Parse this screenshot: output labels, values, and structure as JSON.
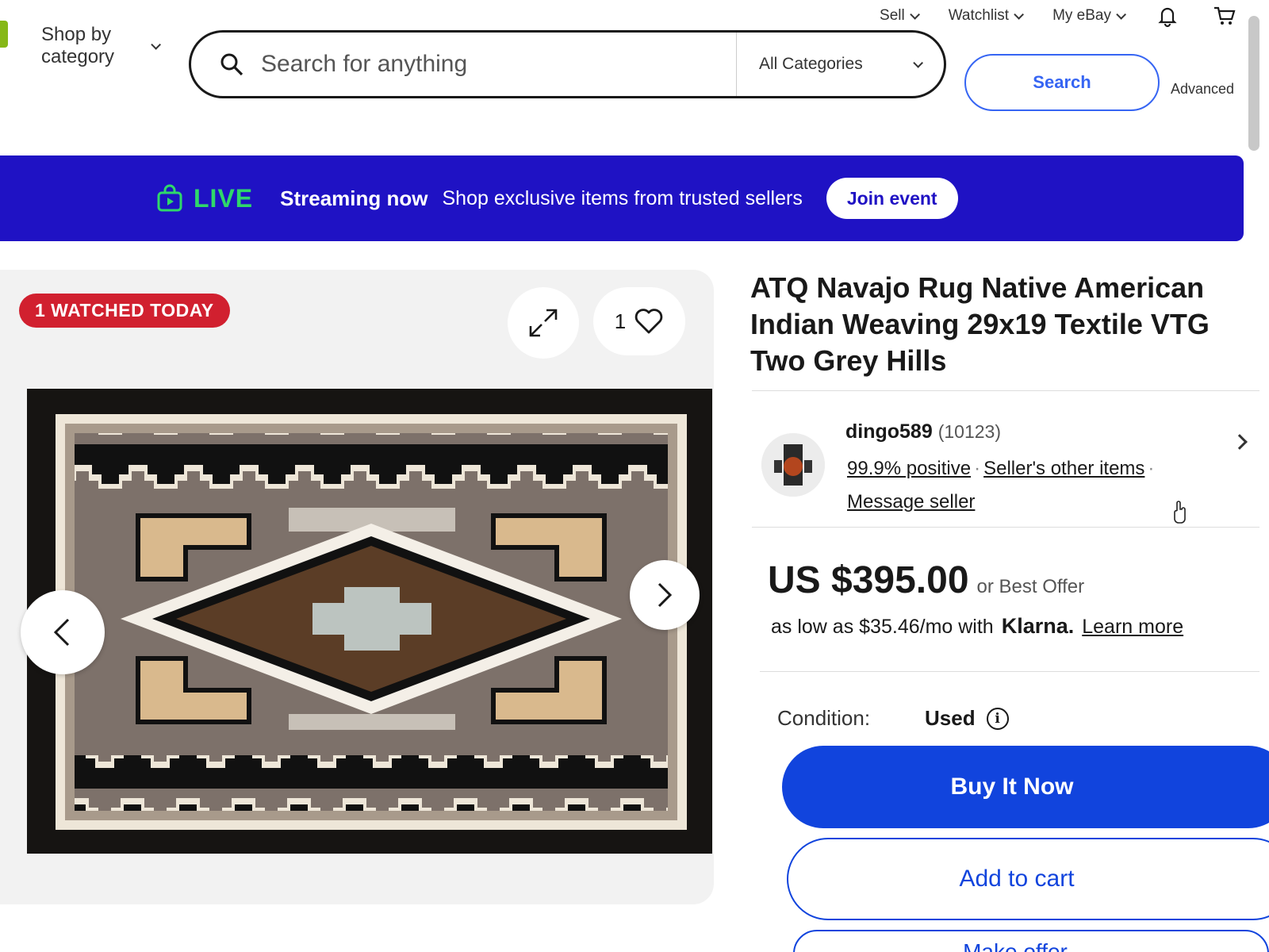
{
  "header": {
    "shop_by_category": "Shop by category",
    "top_links": [
      {
        "label": "Sell"
      },
      {
        "label": "Watchlist"
      },
      {
        "label": "My eBay"
      }
    ],
    "search": {
      "placeholder": "Search for anything",
      "category": "All Categories",
      "button": "Search",
      "advanced": "Advanced"
    },
    "icons": [
      "search-icon",
      "bell-icon",
      "cart-icon",
      "chevron-down-icon"
    ]
  },
  "live_banner": {
    "live": "LIVE",
    "streaming": "Streaming now",
    "message": "Shop exclusive items from trusted sellers",
    "button": "Join event",
    "background": "#1f12c4",
    "live_color": "#2fd86a"
  },
  "gallery": {
    "badge": "1 WATCHED TODAY",
    "watch_count": "1",
    "icons": [
      "expand-icon",
      "heart-icon",
      "chevron-left-icon",
      "chevron-right-icon"
    ]
  },
  "item": {
    "title": "ATQ Navajo Rug Native American Indian Weaving 29x19 Textile VTG Two Grey Hills",
    "seller": {
      "name": "dingo589",
      "feedback": "(10123)",
      "positive": "99.9% positive",
      "other_items": "Seller's other items",
      "message": "Message seller"
    },
    "price": "US $395.00",
    "best_offer": "or Best Offer",
    "klarna": {
      "prefix": "as low as $35.46/mo with",
      "brand": "Klarna.",
      "learn_more": "Learn more"
    },
    "condition_label": "Condition:",
    "condition_value": "Used",
    "buttons": {
      "buy": "Buy It Now",
      "cart": "Add to cart",
      "offer": "Make offer"
    },
    "accent": "#1144dd",
    "badge_color": "#d1202f"
  }
}
